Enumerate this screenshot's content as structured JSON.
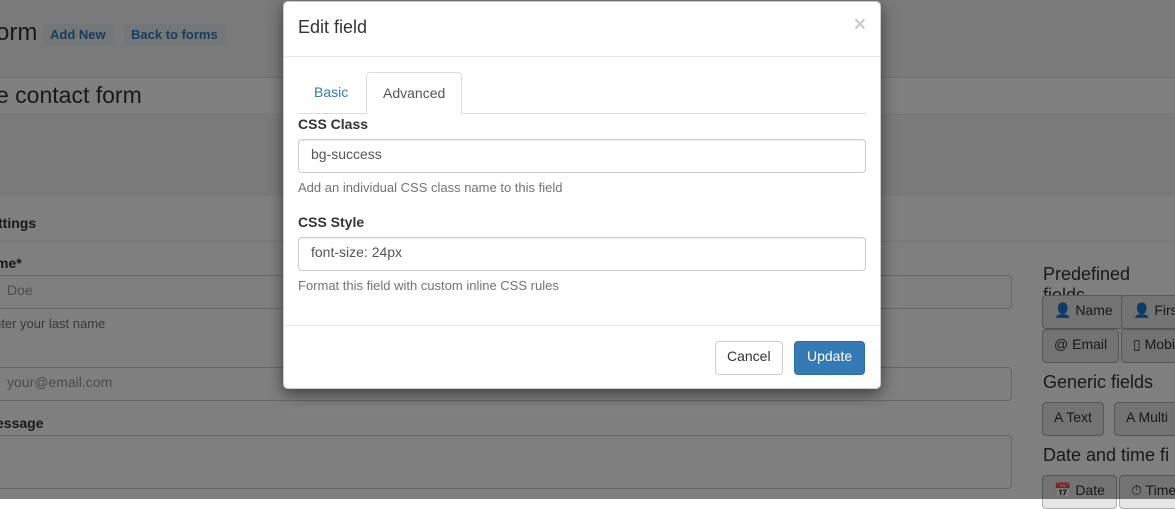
{
  "app": {
    "heading_fragment": "orm",
    "add_new_label": "Add New",
    "back_label": "Back to forms",
    "form_title_fragment": "e contact form"
  },
  "form": {
    "settings_heading_fragment": "ttings",
    "name_label_fragment": "me*",
    "last_name_placeholder": "Doe",
    "last_name_help_fragment": "nter your last name",
    "email_placeholder": "your@email.com",
    "message_label_fragment": "essage"
  },
  "sidebar": {
    "predefined_title": "Predefined fields",
    "predefined_buttons": [
      "👤 Name",
      "👤 First",
      "@ Email",
      "▯ Mobile"
    ],
    "generic_title": "Generic fields",
    "generic_buttons": [
      "A Text",
      "A Multi"
    ],
    "datetime_title": "Date and time fi",
    "datetime_buttons": [
      "📅 Date",
      "⏱ Time"
    ]
  },
  "modal": {
    "title": "Edit field",
    "close_glyph": "×",
    "tabs": [
      {
        "label": "Basic",
        "active": false
      },
      {
        "label": "Advanced",
        "active": true
      }
    ],
    "css_class": {
      "label": "CSS Class",
      "value": "bg-success",
      "help": "Add an individual CSS class name to this field"
    },
    "css_style": {
      "label": "CSS Style",
      "value": "font-size: 24px",
      "help": "Format this field with custom inline CSS rules"
    },
    "cancel_label": "Cancel",
    "update_label": "Update"
  },
  "colors": {
    "primary": "#337ab7",
    "backdrop": "rgba(0,0,0,0.5)"
  }
}
